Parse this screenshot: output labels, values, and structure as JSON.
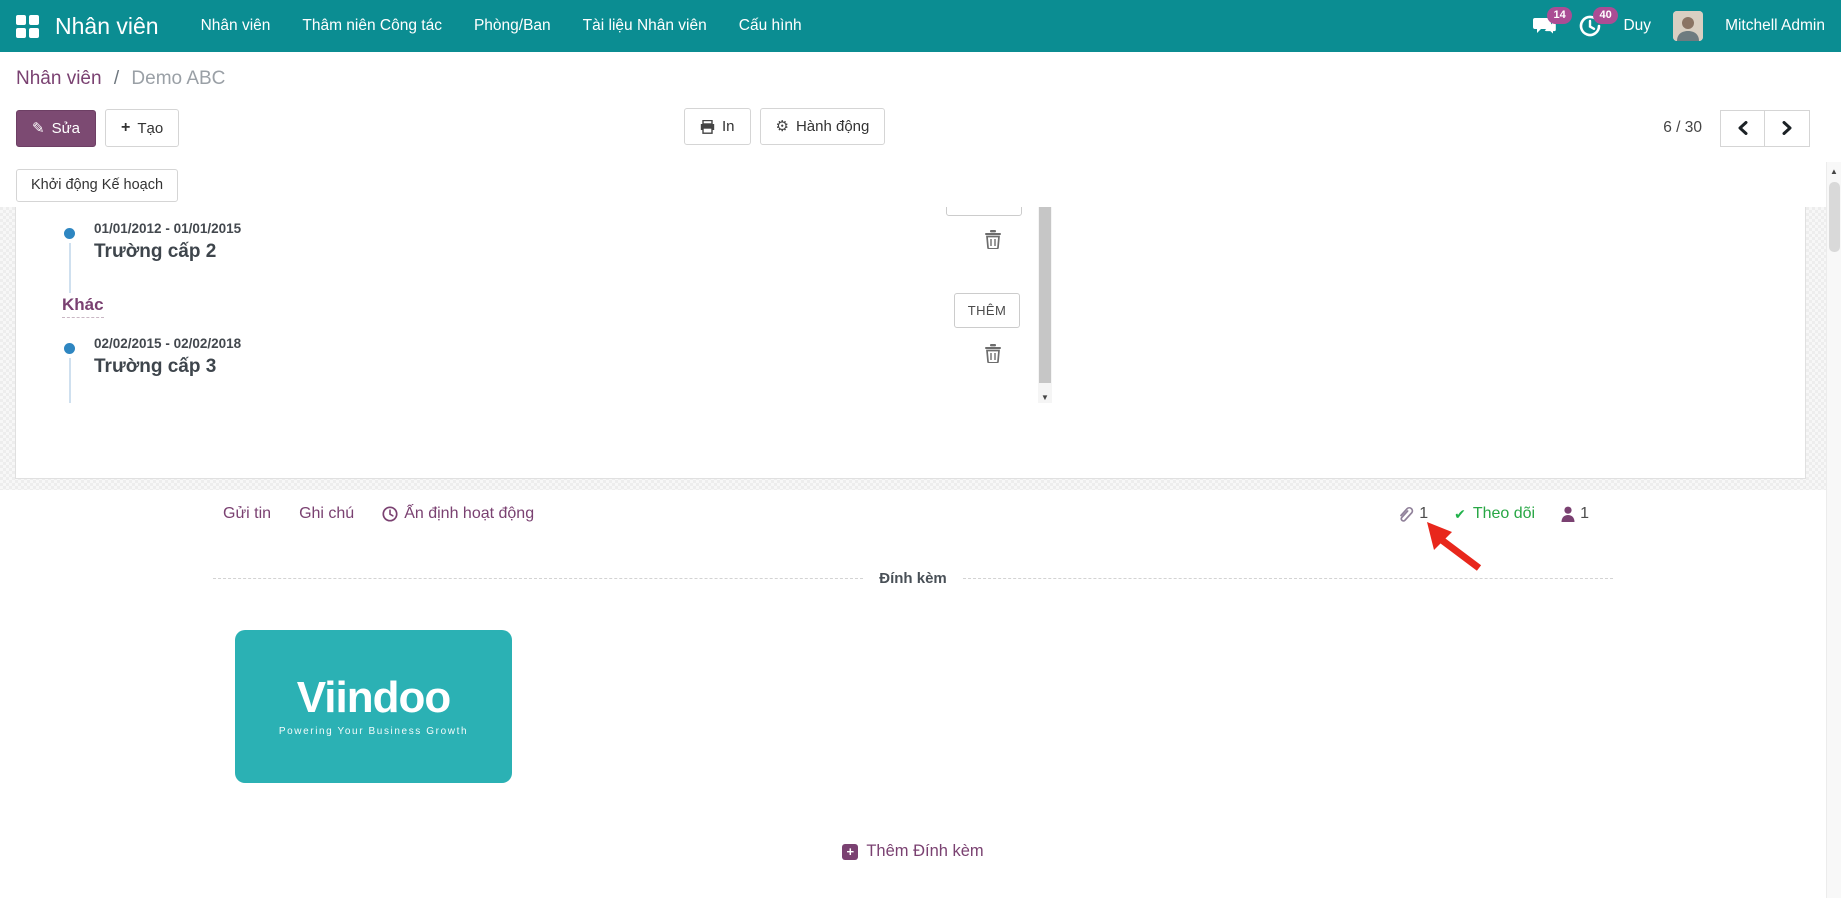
{
  "colors": {
    "navbar_teal": "#0B8D92",
    "badge_magenta": "#AA4D94",
    "primary_purple": "#7A4171",
    "success_green": "#28A745",
    "timeline_blue": "#2E86C1",
    "attachment_teal": "#2BB1B4",
    "annotation_red": "#E8271C"
  },
  "navbar": {
    "brand": "Nhân viên",
    "menu_items": [
      "Nhân viên",
      "Thâm niên Công tác",
      "Phòng/Ban",
      "Tài liệu Nhân viên",
      "Cấu hình"
    ],
    "messages_badge": "14",
    "activities_badge": "40",
    "company": "Duy",
    "user_name": "Mitchell Admin"
  },
  "breadcrumb": {
    "parent": "Nhân viên",
    "separator": "/",
    "current": "Demo ABC"
  },
  "control_panel": {
    "edit_label": "Sửa",
    "create_label": "Tạo",
    "print_label": "In",
    "action_label": "Hành động",
    "pager_value": "6 / 30"
  },
  "form": {
    "launch_plan_label": "Khởi động Kế hoạch",
    "section_label": "Khác",
    "add_button_label": "THÊM",
    "timeline": [
      {
        "dates": "01/01/2012 - 01/01/2015",
        "title": "Trường cấp 2"
      },
      {
        "dates": "02/02/2015 - 02/02/2018",
        "title": "Trường cấp 3"
      }
    ]
  },
  "chatter": {
    "send_label": "Gửi tin",
    "note_label": "Ghi chú",
    "activity_label": "Ấn định hoạt động",
    "attachments_count": "1",
    "follow_label": "Theo dõi",
    "followers_count": "1",
    "divider_label": "Đính kèm",
    "attachment": {
      "logo_text": "Viindoo",
      "tagline": "Powering Your Business Growth"
    },
    "add_attachment_label": "Thêm Đính kèm"
  },
  "glyphs": {
    "pencil": "✎",
    "plus": "+",
    "gear": "⚙",
    "check": "✔",
    "scroll_up": "▲",
    "scroll_down": "▼"
  }
}
